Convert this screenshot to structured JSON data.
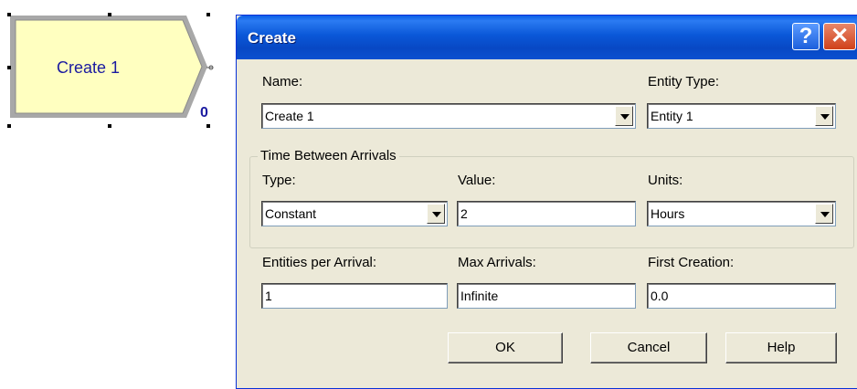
{
  "module": {
    "label": "Create 1",
    "count": "0"
  },
  "dialog": {
    "title": "Create",
    "help_glyph": "?",
    "close_glyph": "✕",
    "name_label": "Name:",
    "name_value": "Create 1",
    "entity_type_label": "Entity Type:",
    "entity_type_value": "Entity 1",
    "group_title": "Time Between Arrivals",
    "type_label": "Type:",
    "type_value": "Constant",
    "value_label": "Value:",
    "value_value": "2",
    "units_label": "Units:",
    "units_value": "Hours",
    "entities_label": "Entities per Arrival:",
    "entities_value": "1",
    "max_label": "Max Arrivals:",
    "max_value": "Infinite",
    "first_label": "First Creation:",
    "first_value": "0.0",
    "ok_label": "OK",
    "cancel_label": "Cancel",
    "help_label": "Help"
  },
  "colors": {
    "module_fill": "#ffffc0",
    "titlebar": "#0a57d8",
    "dialog_bg": "#ece9d8"
  }
}
